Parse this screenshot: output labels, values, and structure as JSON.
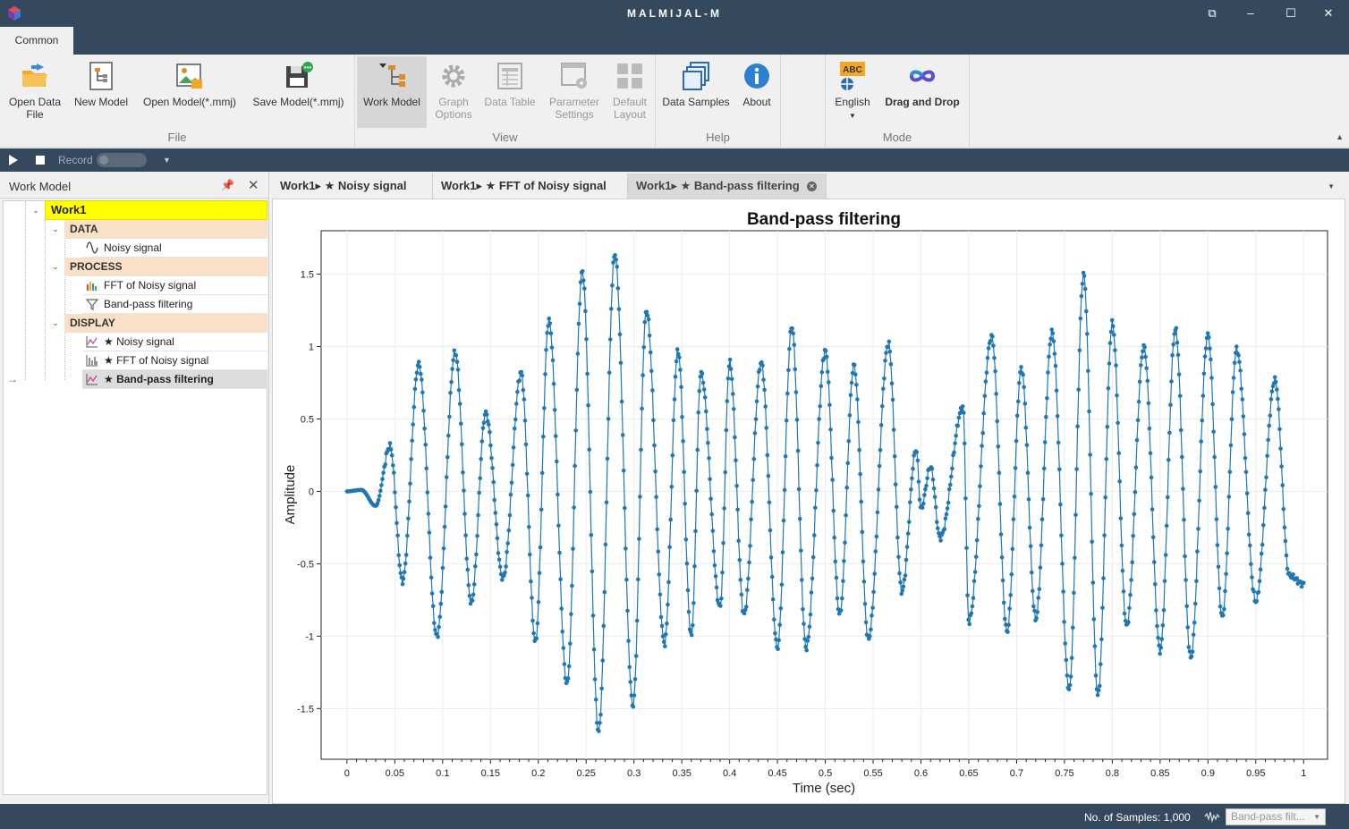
{
  "window": {
    "title": "MALMIJAL-M",
    "controls": [
      "restore-layout-icon",
      "minimize-icon",
      "maximize-icon",
      "close-icon"
    ]
  },
  "ribbon": {
    "tab": "Common",
    "groups": {
      "file": {
        "label": "File",
        "open_data_file_1": "Open Data",
        "open_data_file_2": "File",
        "new_model": "New Model",
        "open_model": "Open Model(*.mmj)",
        "save_model": "Save Model(*.mmj)"
      },
      "view": {
        "label": "View",
        "work_model": "Work Model",
        "graph_options_1": "Graph",
        "graph_options_2": "Options",
        "data_table": "Data Table",
        "parameter_settings_1": "Parameter",
        "parameter_settings_2": "Settings",
        "default_layout_1": "Default",
        "default_layout_2": "Layout"
      },
      "help": {
        "label": "Help",
        "data_samples": "Data Samples",
        "about": "About"
      },
      "mode": {
        "label": "Mode",
        "language": "English",
        "language_badge": "ABC",
        "drag_and_drop": "Drag and Drop"
      }
    }
  },
  "recordbar": {
    "record_label": "Record"
  },
  "work_model_panel": {
    "title": "Work Model",
    "root": "Work1",
    "categories": {
      "data": "DATA",
      "process": "PROCESS",
      "display": "DISPLAY"
    },
    "items": {
      "noisy_signal": "Noisy signal",
      "fft": "FFT of Noisy signal",
      "bandpass": "Band-pass filtering",
      "disp_noisy": "★ Noisy signal",
      "disp_fft": "★ FFT of Noisy signal",
      "disp_bandpass": "★ Band-pass filtering"
    },
    "current_marker": "→"
  },
  "doc_tabs": [
    {
      "label": "Work1▸ ★ Noisy signal"
    },
    {
      "label": "Work1▸ ★ FFT of Noisy signal"
    },
    {
      "label": "Work1▸ ★ Band-pass filtering"
    }
  ],
  "chart_data": {
    "type": "line",
    "title": "Band-pass filtering",
    "xlabel": "Time (sec)",
    "ylabel": "Amplitude",
    "xlim": [
      -0.027,
      1.025
    ],
    "ylim": [
      -1.85,
      1.8
    ],
    "x_ticks": [
      "0",
      "0.05",
      "0.1",
      "0.15",
      "0.2",
      "0.25",
      "0.3",
      "0.35",
      "0.4",
      "0.45",
      "0.5",
      "0.55",
      "0.6",
      "0.65",
      "0.7",
      "0.75",
      "0.8",
      "0.85",
      "0.9",
      "0.95",
      "1"
    ],
    "y_ticks": [
      "1.5",
      "1",
      "0.5",
      "0",
      "-0.5",
      "-1",
      "-1.5"
    ],
    "series_color": "#1f77b4",
    "markers": true,
    "grid": true,
    "samples_shown": 1000,
    "peaks": [
      [
        0,
        0
      ],
      [
        0.015,
        0.01
      ],
      [
        0.03,
        -0.1
      ],
      [
        0.045,
        0.31
      ],
      [
        0.058,
        -0.62
      ],
      [
        0.075,
        0.88
      ],
      [
        0.094,
        -1.0
      ],
      [
        0.113,
        0.96
      ],
      [
        0.13,
        -0.77
      ],
      [
        0.145,
        0.54
      ],
      [
        0.163,
        -0.6
      ],
      [
        0.182,
        0.82
      ],
      [
        0.197,
        -1.04
      ],
      [
        0.211,
        1.18
      ],
      [
        0.23,
        -1.33
      ],
      [
        0.246,
        1.52
      ],
      [
        0.263,
        -1.66
      ],
      [
        0.28,
        1.64
      ],
      [
        0.299,
        -1.48
      ],
      [
        0.313,
        1.25
      ],
      [
        0.332,
        -1.05
      ],
      [
        0.346,
        0.97
      ],
      [
        0.36,
        -1.0
      ],
      [
        0.37,
        0.82
      ],
      [
        0.39,
        -0.8
      ],
      [
        0.4,
        0.89
      ],
      [
        0.415,
        -0.85
      ],
      [
        0.433,
        0.89
      ],
      [
        0.45,
        -1.08
      ],
      [
        0.465,
        1.14
      ],
      [
        0.48,
        -1.08
      ],
      [
        0.5,
        0.97
      ],
      [
        0.515,
        -0.85
      ],
      [
        0.53,
        0.87
      ],
      [
        0.545,
        -1.02
      ],
      [
        0.566,
        1.02
      ],
      [
        0.58,
        -0.69
      ],
      [
        0.595,
        0.29
      ],
      [
        0.6,
        -0.12
      ],
      [
        0.61,
        0.17
      ],
      [
        0.62,
        -0.32
      ],
      [
        0.644,
        0.58
      ],
      [
        0.65,
        -0.9
      ],
      [
        0.674,
        1.07
      ],
      [
        0.69,
        -0.97
      ],
      [
        0.705,
        0.85
      ],
      [
        0.72,
        -0.88
      ],
      [
        0.737,
        1.1
      ],
      [
        0.755,
        -1.37
      ],
      [
        0.77,
        1.5
      ],
      [
        0.785,
        -1.41
      ],
      [
        0.8,
        1.16
      ],
      [
        0.815,
        -0.93
      ],
      [
        0.833,
        1.0
      ],
      [
        0.85,
        -1.1
      ],
      [
        0.866,
        1.12
      ],
      [
        0.882,
        -1.15
      ],
      [
        0.9,
        1.08
      ],
      [
        0.915,
        -0.87
      ],
      [
        0.93,
        0.98
      ],
      [
        0.95,
        -0.76
      ],
      [
        0.97,
        0.77
      ],
      [
        0.985,
        -0.58
      ],
      [
        1.0,
        -0.64
      ]
    ]
  },
  "status": {
    "samples": "No. of Samples: 1,000",
    "selector": "Band-pass filt..."
  }
}
